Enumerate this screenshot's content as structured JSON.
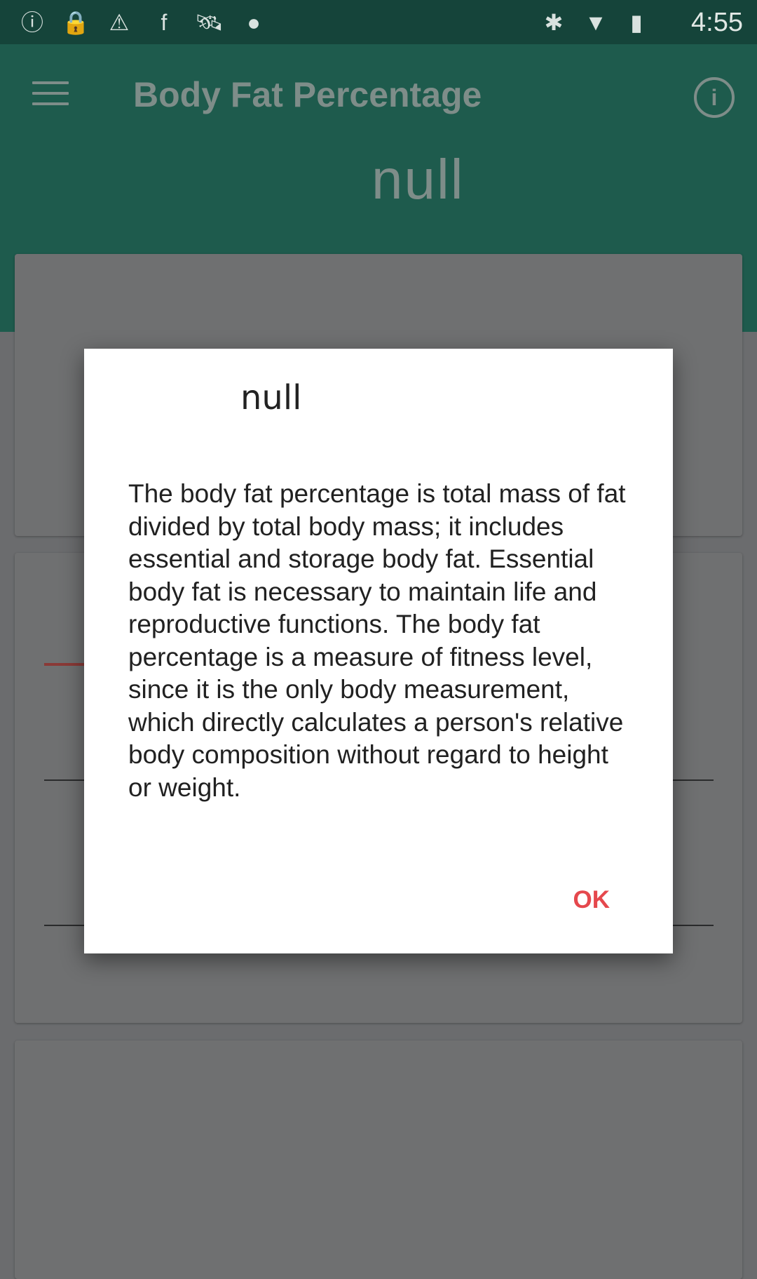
{
  "status_bar": {
    "time": "4:55",
    "icons": [
      "info-circle-icon",
      "lock-icon",
      "warning-icon",
      "facebook-icon",
      "fake-gps-icon",
      "android-icon",
      "bluetooth-icon",
      "wifi-icon",
      "battery-charging-icon"
    ]
  },
  "app_bar": {
    "title": "Body Fat Percentage",
    "value": "null",
    "menu_icon": "hamburger-menu-icon",
    "info_icon": "info-icon"
  },
  "dialog": {
    "title": "null",
    "body": "The body fat percentage is total mass of fat divided by total body mass; it includes essential and storage body fat. Essential body fat is necessary to maintain life and reproductive functions. The body fat percentage is a measure of fitness level, since it is the only body measurement, which directly calculates a person's relative body composition without regard to height or weight.",
    "ok_label": "OK"
  },
  "colors": {
    "app_bar": "#1e5b4d",
    "status_bar": "#15443a",
    "accent": "#e5484d",
    "scrim_bg": "#6b6c6e"
  }
}
